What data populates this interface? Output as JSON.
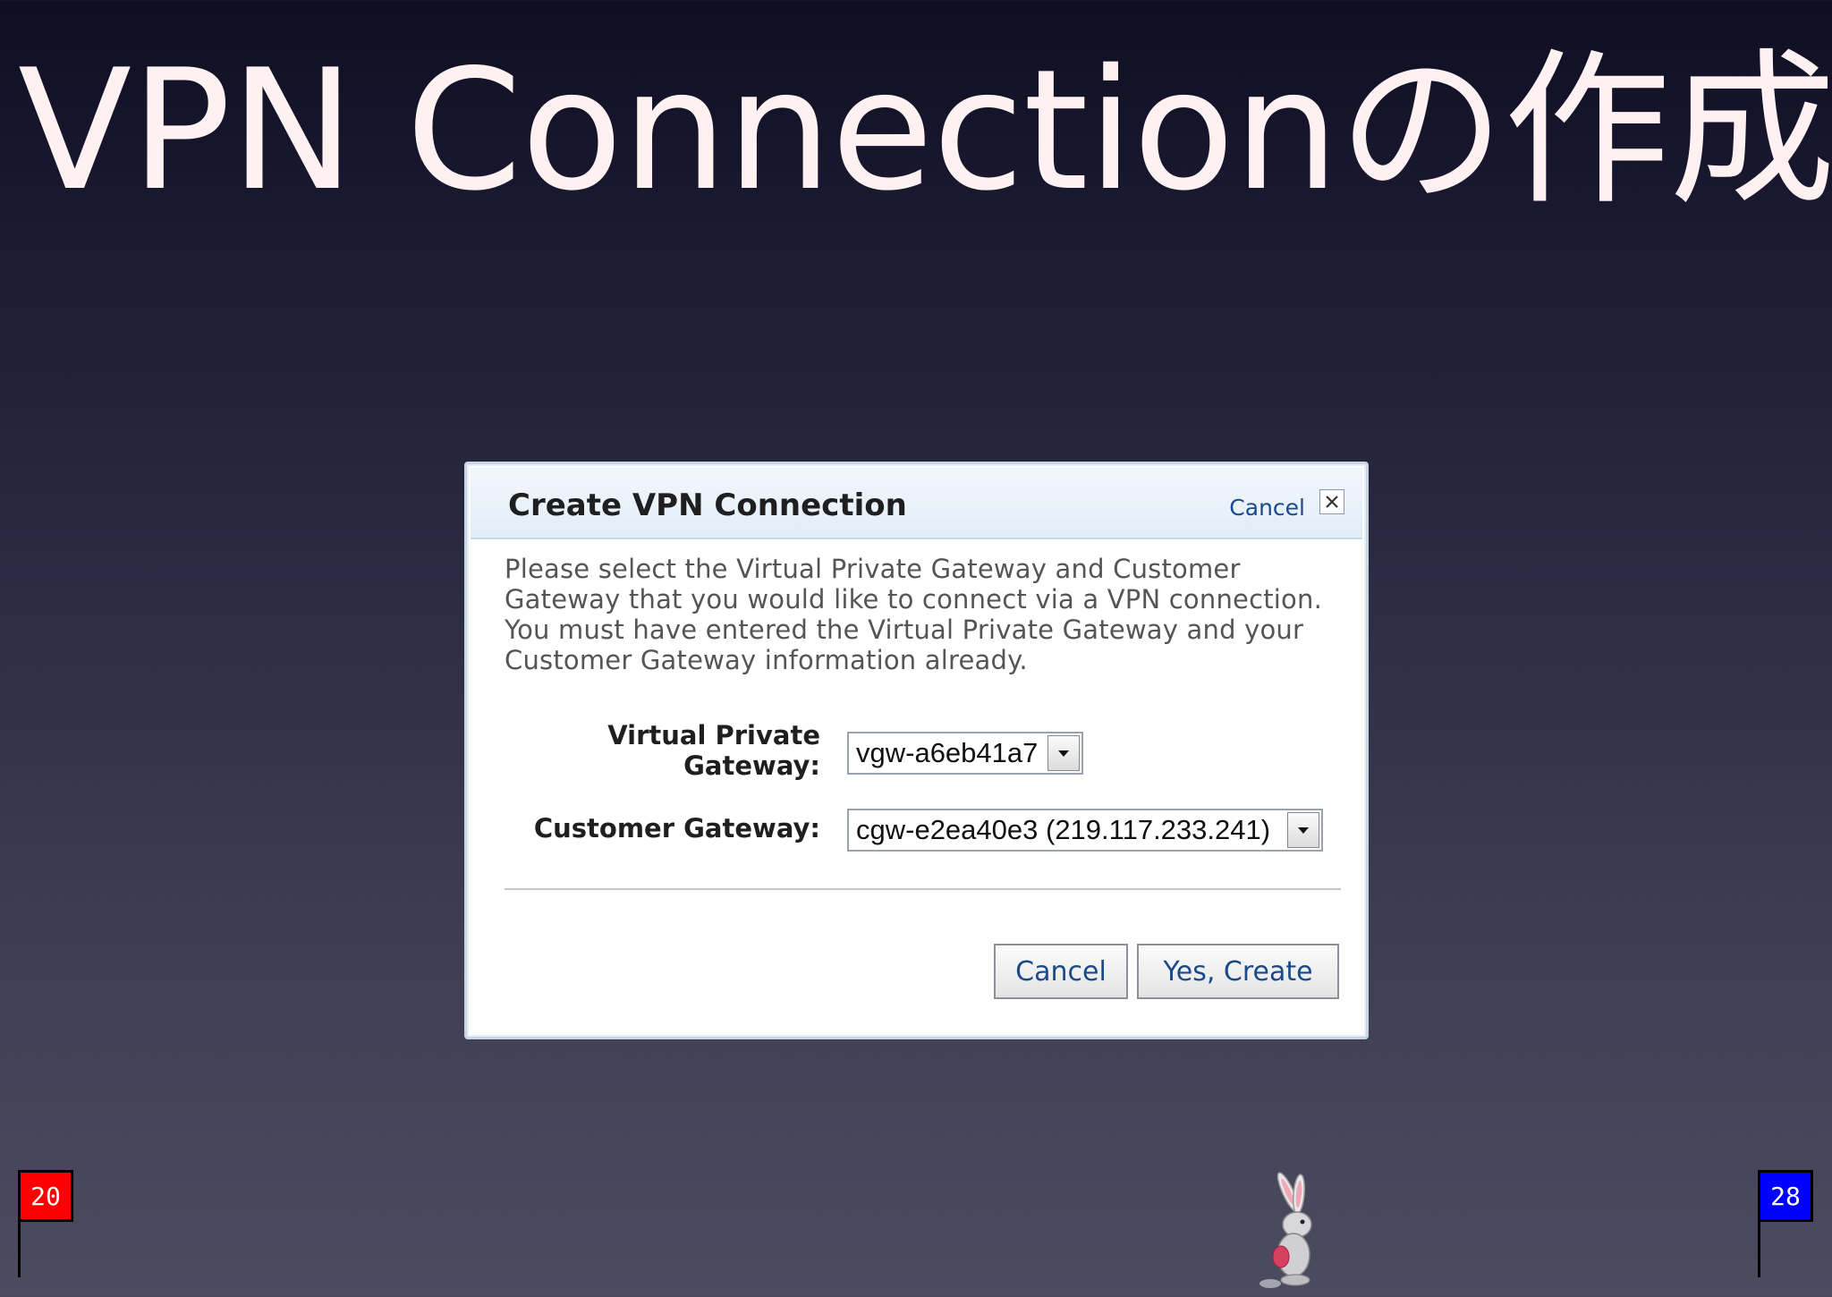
{
  "slide": {
    "title": "VPN Connectionの作成"
  },
  "dialog": {
    "title": "Create VPN Connection",
    "header_cancel_label": "Cancel",
    "close_icon": "close-icon",
    "description": "Please select the Virtual Private Gateway and Customer Gateway that you would like to connect via a VPN connection. You must have entered the Virtual Private Gateway and your Customer Gateway information already.",
    "fields": {
      "vpg_label_line1": "Virtual Private",
      "vpg_label_line2": "Gateway:",
      "vpg_value": "vgw-a6eb41a7",
      "cgw_label": "Customer Gateway:",
      "cgw_value": "cgw-e2ea40e3 (219.117.233.241)"
    },
    "buttons": {
      "cancel": "Cancel",
      "create": "Yes, Create"
    }
  },
  "page_flags": {
    "left": {
      "number": "20",
      "color": "#ff0000"
    },
    "right": {
      "number": "28",
      "color": "#0000ff"
    }
  },
  "mascot_icon": "rabbit-icon"
}
